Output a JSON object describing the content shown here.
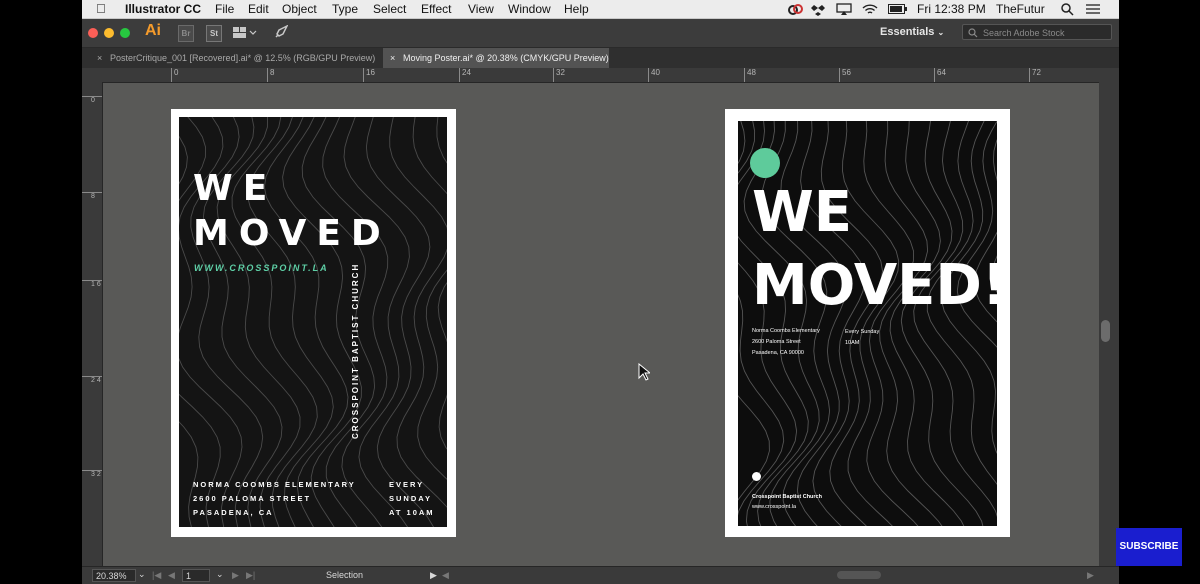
{
  "menubar": {
    "app_name": "Illustrator CC",
    "items": [
      "File",
      "Edit",
      "Object",
      "Type",
      "Select",
      "Effect",
      "View",
      "Window",
      "Help"
    ],
    "clock": "Fri 12:38 PM",
    "user": "TheFutur"
  },
  "controlbar": {
    "ai_logo": "Ai",
    "br_logo": "Br",
    "st_logo": "St",
    "workspace": "Essentials",
    "search_placeholder": "Search Adobe Stock"
  },
  "tabs": [
    {
      "label": "PosterCritique_001 [Recovered].ai* @ 12.5% (RGB/GPU Preview)",
      "active": false
    },
    {
      "label": "Moving Poster.ai* @ 20.38% (CMYK/GPU Preview)",
      "active": true
    }
  ],
  "ruler": {
    "h_labels": [
      "0",
      "8",
      "16",
      "24",
      "32",
      "40",
      "48",
      "56",
      "64",
      "72"
    ],
    "v_labels": [
      "0",
      "8",
      "1 6",
      "2 4",
      "3 2"
    ]
  },
  "poster_left": {
    "headline_1": "WE",
    "headline_2": "MOVED",
    "url": "WWW.CROSSPOINT.LA",
    "vertical_text": "CROSSPOINT BAPTIST CHURCH",
    "address": [
      "NORMA COOMBS ELEMENTARY",
      "2600 PALOMA STREET",
      "PASADENA, CA"
    ],
    "time": [
      "EVERY",
      "SUNDAY",
      "AT 10AM"
    ]
  },
  "poster_right": {
    "headline_1": "WE",
    "headline_2": "MOVED!",
    "address": [
      "Norma Coombs Elementary",
      "2600 Paloma Street",
      "Pasadena, CA 90000"
    ],
    "time": [
      "Every Sunday",
      "10AM"
    ],
    "church": "Crosspoint Baptist Church",
    "url": "www.crosspoint.la",
    "accent_color": "#5ecb9b"
  },
  "statusbar": {
    "zoom": "20.38%",
    "artboard": "1",
    "tool": "Selection"
  },
  "overlay": {
    "subscribe": "SUBSCRIBE"
  }
}
